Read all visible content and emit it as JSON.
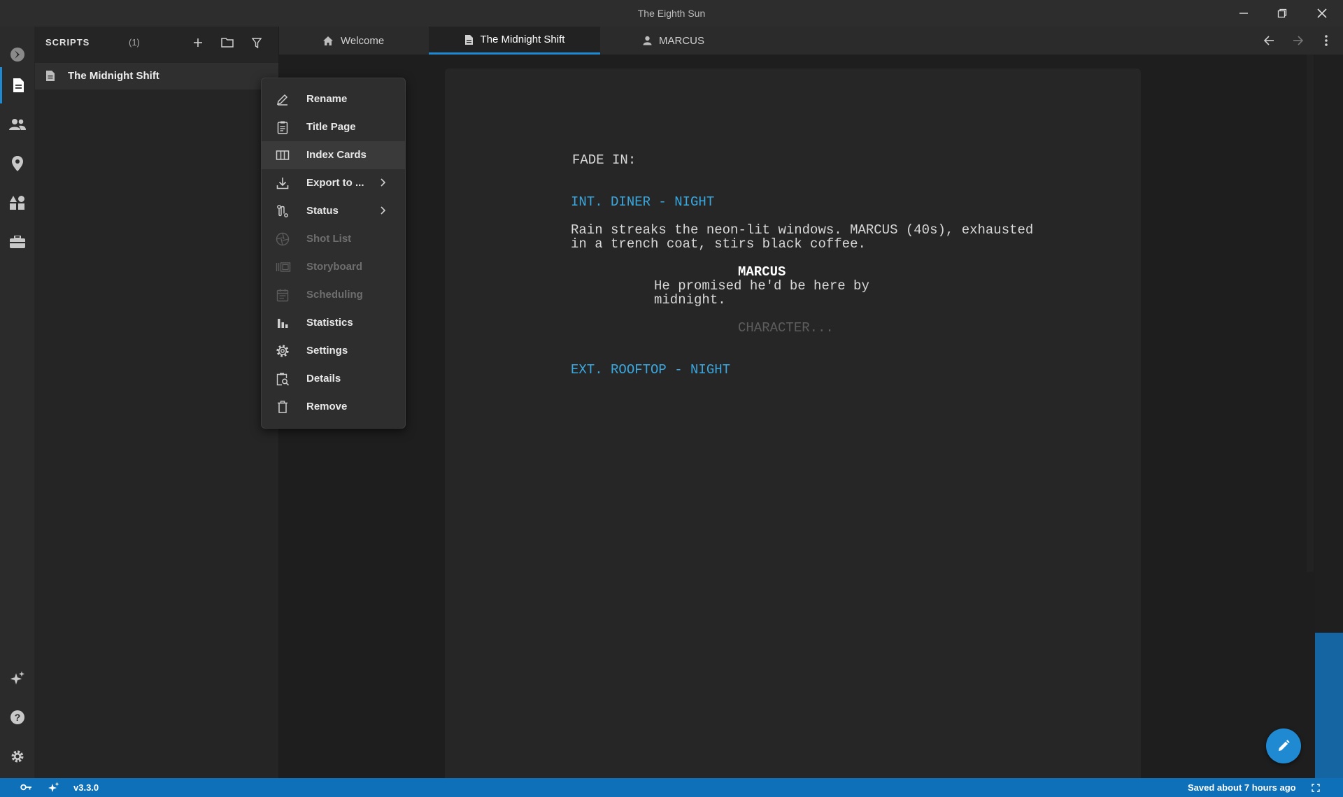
{
  "window": {
    "title": "The Eighth Sun"
  },
  "sidebar": {
    "title": "SCRIPTS",
    "count": "(1)",
    "items": [
      {
        "label": "The Midnight Shift",
        "icon": "document-icon"
      }
    ]
  },
  "activity_bar": {
    "top": [
      "logo-icon",
      "scripts-icon",
      "characters-icon",
      "locations-icon",
      "elements-icon",
      "toolbox-icon"
    ],
    "bottom": [
      "ai-sparkle-icon",
      "help-icon",
      "settings-gear-icon"
    ]
  },
  "tabs": [
    {
      "label": "Welcome",
      "icon": "home-icon"
    },
    {
      "label": "The Midnight Shift",
      "icon": "document-icon",
      "active": true
    },
    {
      "label": "MARCUS",
      "icon": "person-icon"
    }
  ],
  "context_menu": {
    "items": [
      {
        "label": "Rename",
        "icon": "pencil-icon"
      },
      {
        "label": "Title Page",
        "icon": "clipboard-icon"
      },
      {
        "label": "Index Cards",
        "icon": "columns-icon",
        "highlighted": true
      },
      {
        "label": "Export to ...",
        "icon": "download-icon",
        "submenu": true
      },
      {
        "label": "Status",
        "icon": "status-icon",
        "submenu": true
      },
      {
        "label": "Shot List",
        "icon": "aperture-icon",
        "disabled": true
      },
      {
        "label": "Storyboard",
        "icon": "storyboard-icon",
        "disabled": true
      },
      {
        "label": "Scheduling",
        "icon": "calendar-icon",
        "disabled": true
      },
      {
        "label": "Statistics",
        "icon": "bar-chart-icon"
      },
      {
        "label": "Settings",
        "icon": "gear-icon"
      },
      {
        "label": "Details",
        "icon": "details-icon"
      },
      {
        "label": "Remove",
        "icon": "trash-icon"
      }
    ]
  },
  "script": {
    "transition": "FADE IN:",
    "scene1": "INT. DINER - NIGHT",
    "action1_line1": "Rain streaks the neon-lit windows. MARCUS (40s), exhausted",
    "action1_line2": "in a trench coat, stirs black coffee.",
    "character": "MARCUS",
    "dialogue_line1": "He promised he'd be here by",
    "dialogue_line2": "midnight.",
    "character_placeholder": "CHARACTER...",
    "scene2": "EXT. ROOFTOP - NIGHT"
  },
  "status_bar": {
    "version": "v3.3.0",
    "saved": "Saved about 7 hours ago"
  },
  "colors": {
    "accent": "#1f8ad2",
    "status_bar": "#0e70b8",
    "scene_heading": "#3aa8e0"
  }
}
